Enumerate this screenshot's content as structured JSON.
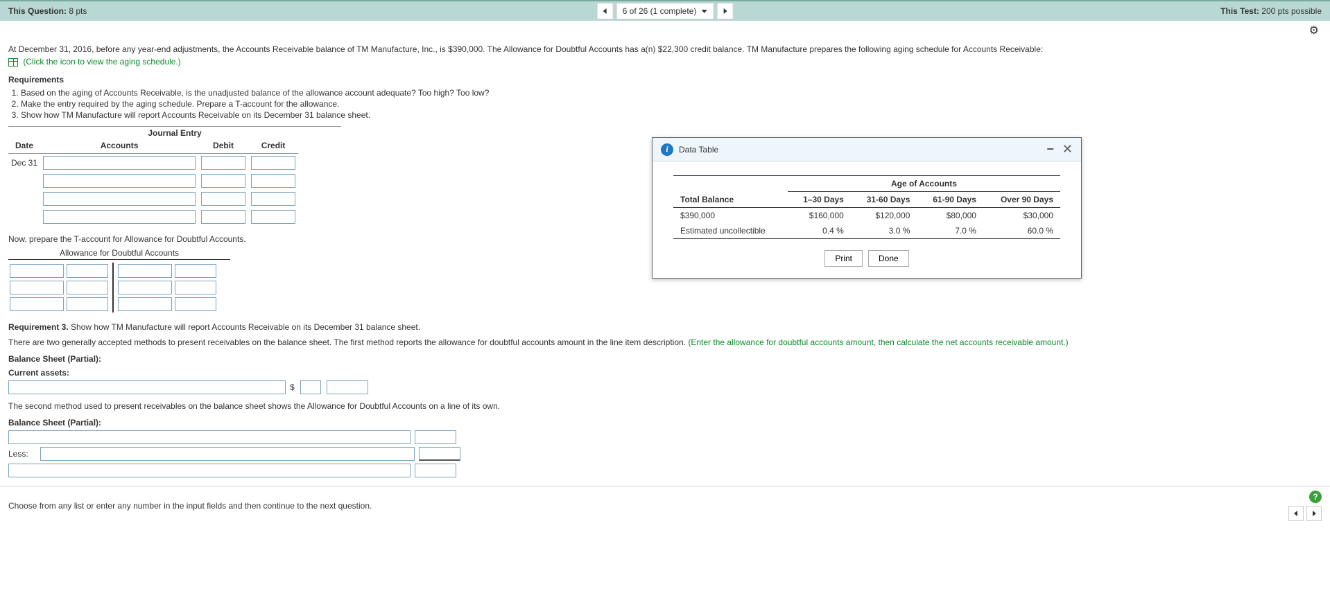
{
  "header": {
    "question_label": "This Question:",
    "question_pts": " 8 pts",
    "nav_text": "6 of 26 (1 complete)",
    "test_label": "This Test:",
    "test_pts": " 200 pts possible"
  },
  "intro": "At December 31, 2016, before any year-end adjustments, the Accounts Receivable balance of TM Manufacture, Inc., is $390,000. The Allowance for Doubtful Accounts has a(n) $22,300 credit balance. TM Manufacture prepares the following aging schedule for Accounts Receivable:",
  "icon_link": "(Click the icon to view the aging schedule.)",
  "requirements_head": "Requirements",
  "requirements": [
    "Based on the aging of Accounts Receivable, is the unadjusted balance of the allowance account adequate? Too high? Too low?",
    "Make the entry required by the aging schedule. Prepare a T-account for the allowance.",
    "Show how TM Manufacture will report Accounts Receivable on its December 31 balance sheet."
  ],
  "journal": {
    "title": "Journal Entry",
    "cols": [
      "Date",
      "Accounts",
      "Debit",
      "Credit"
    ],
    "date": "Dec 31"
  },
  "t_prompt": "Now, prepare the T-account for Allowance for Doubtful Accounts.",
  "t_title": "Allowance for Doubtful Accounts",
  "req3": {
    "label": "Requirement 3.",
    "text": " Show how TM Manufacture will report Accounts Receivable on its December 31 balance sheet.",
    "method1_a": "There are two generally accepted methods to present receivables on the balance sheet. The first method reports the allowance for doubtful accounts amount in the line item description. ",
    "method1_b": "(Enter the allowance for doubtful accounts amount, then calculate the net accounts receivable amount.)",
    "bs_partial": "Balance Sheet (Partial):",
    "current_assets": "Current assets:",
    "method2": "The second method used to present receivables on the balance sheet shows the Allowance for Doubtful Accounts on a line of its own.",
    "less": "Less:",
    "dollar": "$"
  },
  "popup": {
    "title": "Data Table",
    "age_head": "Age of Accounts",
    "cols": [
      "Total Balance",
      "1–30 Days",
      "31-60 Days",
      "61-90 Days",
      "Over 90 Days"
    ],
    "row_balance": [
      "$390,000",
      "$160,000",
      "$120,000",
      "$80,000",
      "$30,000"
    ],
    "row_est_label": "Estimated uncollectible",
    "row_est": [
      "0.4 %",
      "3.0 %",
      "7.0 %",
      "60.0 %"
    ],
    "print": "Print",
    "done": "Done"
  },
  "footer": {
    "hint": "Choose from any list or enter any number in the input fields and then continue to the next question."
  }
}
